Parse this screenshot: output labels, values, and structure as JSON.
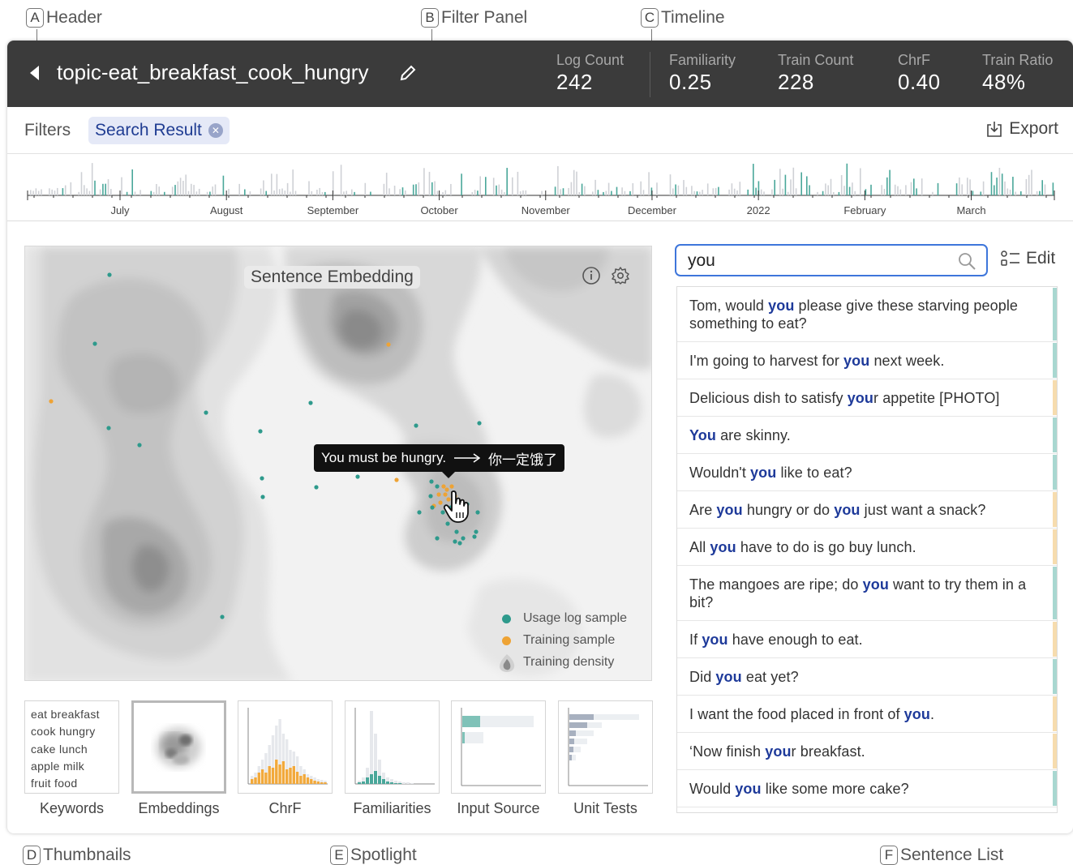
{
  "callouts": {
    "a": {
      "letter": "A",
      "label": "Header"
    },
    "b": {
      "letter": "B",
      "label": "Filter Panel"
    },
    "c": {
      "letter": "C",
      "label": "Timeline"
    },
    "d": {
      "letter": "D",
      "label": "Thumbnails"
    },
    "e": {
      "letter": "E",
      "label": "Spotlight"
    },
    "f": {
      "letter": "F",
      "label": "Sentence List"
    }
  },
  "header": {
    "title": "topic-eat_breakfast_cook_hungry",
    "stats": [
      {
        "label": "Log Count",
        "value": "242"
      },
      {
        "label": "Familiarity",
        "value": "0.25"
      },
      {
        "label": "Train Count",
        "value": "228"
      },
      {
        "label": "ChrF",
        "value": "0.40"
      },
      {
        "label": "Train Ratio",
        "value": "48%"
      }
    ]
  },
  "filters": {
    "label": "Filters",
    "chip": "Search Result",
    "export_label": "Export"
  },
  "timeline": {
    "months": [
      "July",
      "August",
      "September",
      "October",
      "November",
      "December",
      "2022",
      "February",
      "March"
    ]
  },
  "spotlight": {
    "title": "Sentence Embedding",
    "tooltip_source": "You must be hungry.",
    "tooltip_target": "你一定饿了",
    "legend": [
      "Usage log sample",
      "Training sample",
      "Training density"
    ]
  },
  "thumbnails": {
    "keywords_text": [
      "eat  breakfast",
      "cook  hungry",
      "cake  lunch",
      "apple  milk",
      "fruit  food"
    ],
    "labels": [
      "Keywords",
      "Embeddings",
      "ChrF",
      "Familiarities",
      "Input Source",
      "Unit Tests"
    ],
    "selected": "Embeddings"
  },
  "search": {
    "value": "you",
    "edit_label": "Edit"
  },
  "sentences": [
    {
      "parts": [
        "Tom, would ",
        "you",
        " please give these starving people something to eat?"
      ],
      "kind": "log"
    },
    {
      "parts": [
        "I'm going to harvest for ",
        "you",
        " next week."
      ],
      "kind": "log"
    },
    {
      "parts": [
        "Delicious dish to satisfy ",
        "you",
        "r appetite [PHOTO]"
      ],
      "kind": "train"
    },
    {
      "parts": [
        "",
        "You",
        " are skinny."
      ],
      "kind": "log"
    },
    {
      "parts": [
        "Wouldn't ",
        "you",
        " like to eat?"
      ],
      "kind": "log"
    },
    {
      "parts": [
        "Are ",
        "you",
        " hungry or do ",
        "you",
        " just want a snack?"
      ],
      "kind": "train"
    },
    {
      "parts": [
        "All ",
        "you",
        " have to do is go buy lunch."
      ],
      "kind": "train"
    },
    {
      "parts": [
        "The mangoes are ripe; do ",
        "you",
        " want to try them in a bit?"
      ],
      "kind": "log"
    },
    {
      "parts": [
        "If ",
        "you",
        " have enough to eat."
      ],
      "kind": "train"
    },
    {
      "parts": [
        "Did ",
        "you",
        " eat yet?"
      ],
      "kind": "log"
    },
    {
      "parts": [
        "I want the food placed in front of ",
        "you",
        "."
      ],
      "kind": "train"
    },
    {
      "parts": [
        "‘Now finish ",
        "you",
        "r breakfast."
      ],
      "kind": "train"
    },
    {
      "parts": [
        "Would ",
        "you",
        " like some more cake?"
      ],
      "kind": "log"
    }
  ],
  "colors": {
    "log": "#2e9a8c",
    "train": "#eea335",
    "log_bar": "#a8d7d0",
    "train_bar": "#f6dcae",
    "highlight": "#1e3a9a"
  }
}
